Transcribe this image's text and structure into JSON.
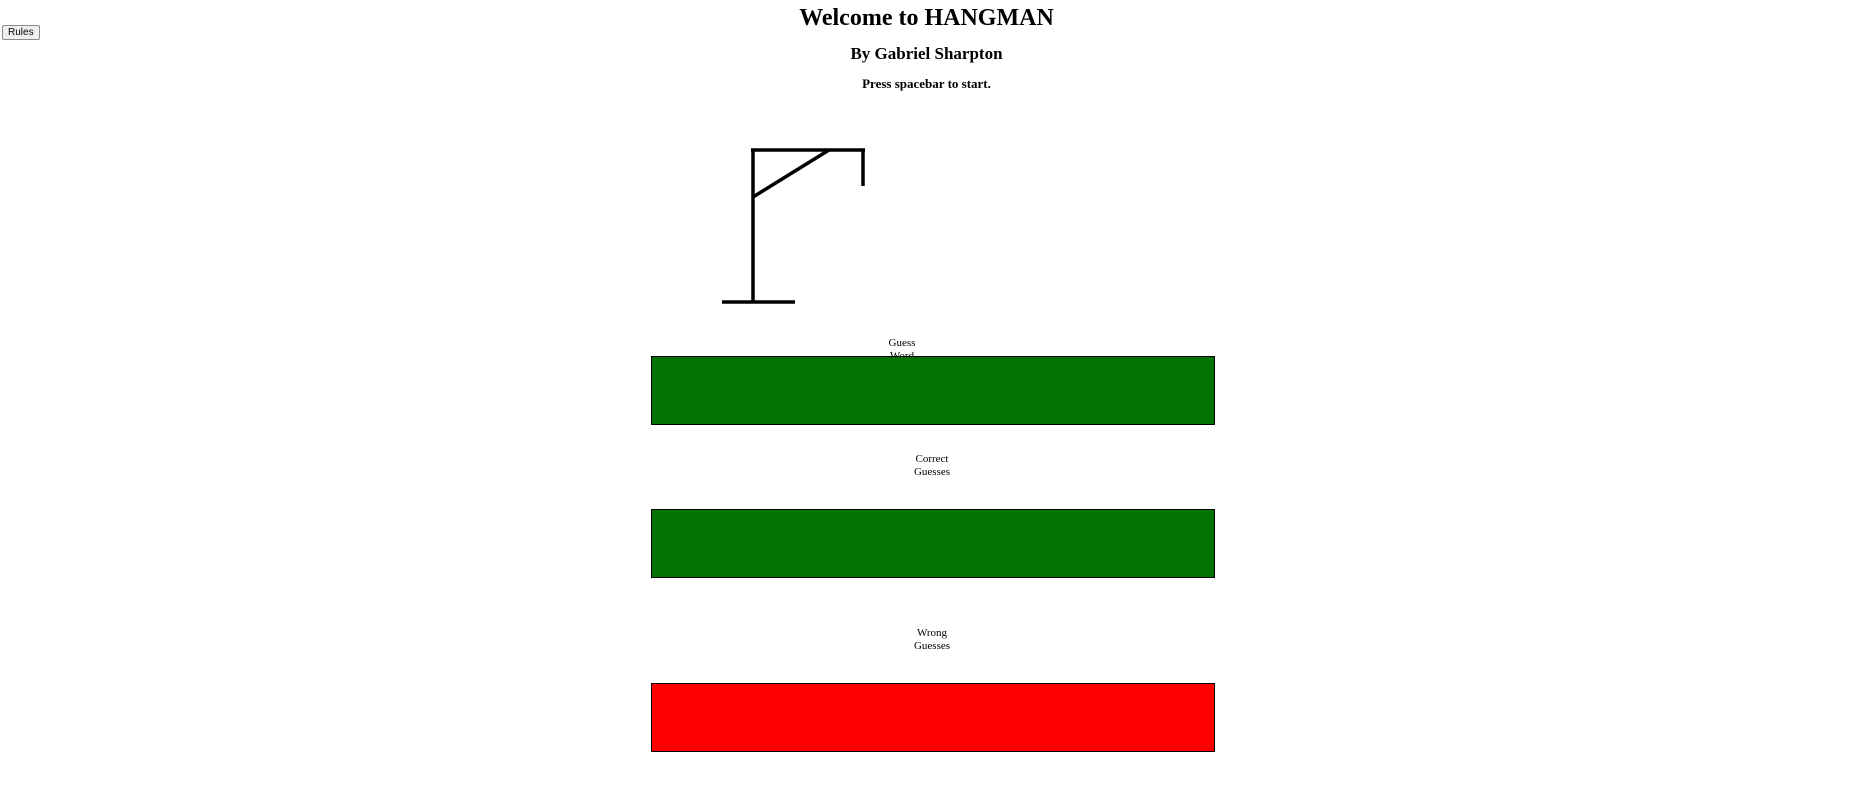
{
  "header": {
    "rules_label": "Rules",
    "title": "Welcome to HANGMAN",
    "author": "By Gabriel Sharpton",
    "prompt": "Press spacebar to start."
  },
  "sections": {
    "guess_word_label": "Guess Word",
    "correct_label": "Correct Guesses",
    "wrong_label": "Wrong Guesses"
  },
  "colors": {
    "guess_word_box": "#037304",
    "correct_box": "#037304",
    "wrong_box": "#ff0000"
  }
}
